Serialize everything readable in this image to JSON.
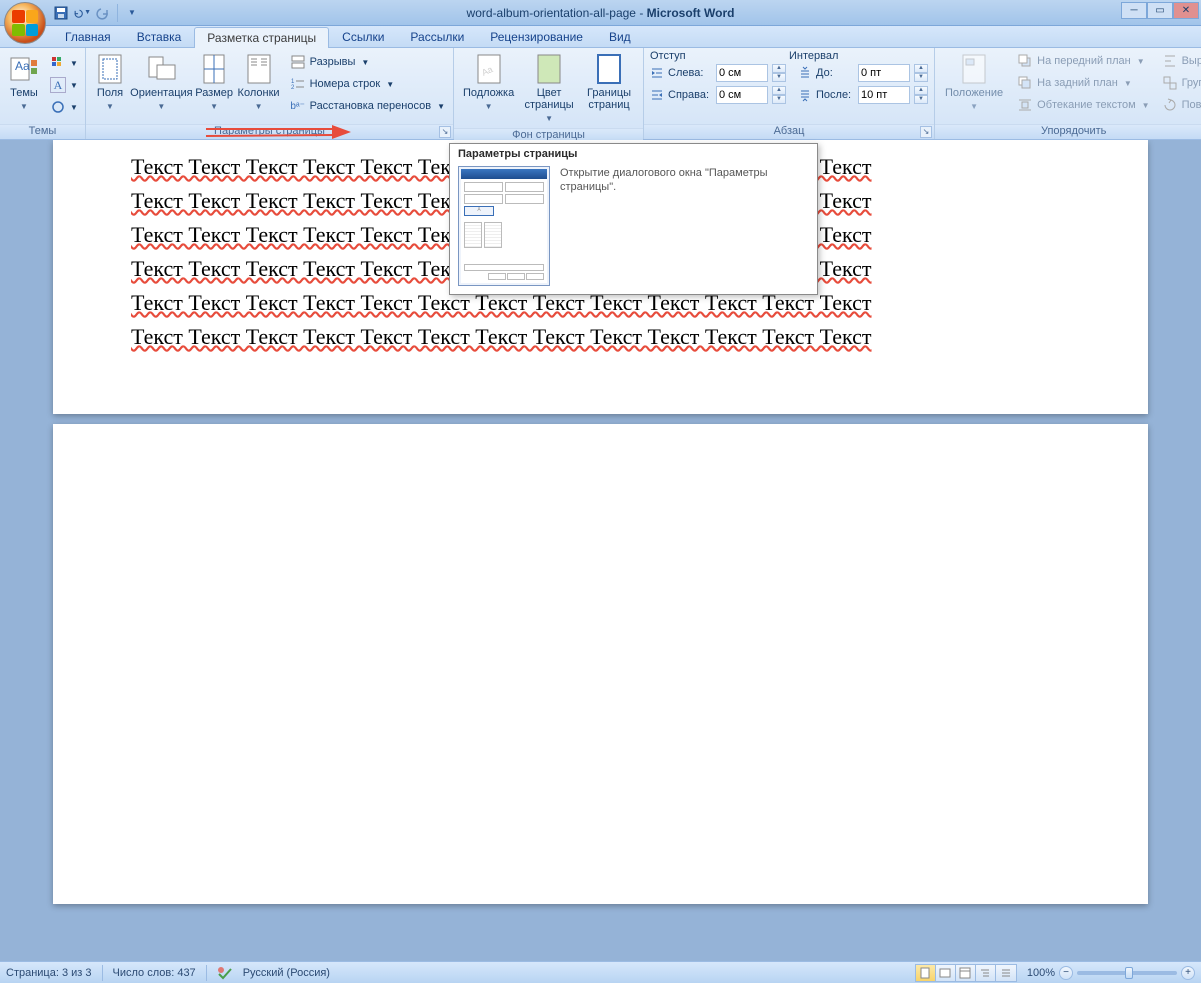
{
  "titlebar": {
    "document": "word-album-orientation-all-page",
    "app": "Microsoft Word",
    "qat_save": "save-icon",
    "qat_undo": "undo-icon",
    "qat_redo": "redo-icon"
  },
  "tabs": {
    "home": "Главная",
    "insert": "Вставка",
    "page_layout": "Разметка страницы",
    "references": "Ссылки",
    "mailings": "Рассылки",
    "review": "Рецензирование",
    "view": "Вид"
  },
  "ribbon": {
    "themes": {
      "label": "Темы",
      "themes_btn": "Темы"
    },
    "page_setup": {
      "label": "Параметры страницы",
      "margins": "Поля",
      "orientation": "Ориентация",
      "size": "Размер",
      "columns": "Колонки",
      "breaks": "Разрывы",
      "line_numbers": "Номера строк",
      "hyphenation": "Расстановка переносов"
    },
    "page_background": {
      "label": "Фон страницы",
      "watermark": "Подложка",
      "page_color": "Цвет страницы",
      "page_borders": "Границы страниц"
    },
    "paragraph": {
      "label": "Абзац",
      "indent_title": "Отступ",
      "indent_left_label": "Слева:",
      "indent_left_value": "0 см",
      "indent_right_label": "Справа:",
      "indent_right_value": "0 см",
      "spacing_title": "Интервал",
      "spacing_before_label": "До:",
      "spacing_before_value": "0 пт",
      "spacing_after_label": "После:",
      "spacing_after_value": "10 пт"
    },
    "arrange": {
      "label": "Упорядочить",
      "position": "Положение",
      "bring_front": "На передний план",
      "send_back": "На задний план",
      "text_wrap": "Обтекание текстом",
      "align": "Выр",
      "group": "Груп",
      "rotate": "Пов"
    }
  },
  "tooltip": {
    "title": "Параметры страницы",
    "description": "Открытие диалогового окна \"Параметры страницы\"."
  },
  "document": {
    "word": "Текст",
    "repeat_per_line": 13,
    "lines": 6
  },
  "status": {
    "page": "Страница: 3 из 3",
    "words": "Число слов: 437",
    "language": "Русский (Россия)",
    "zoom": "100%"
  }
}
